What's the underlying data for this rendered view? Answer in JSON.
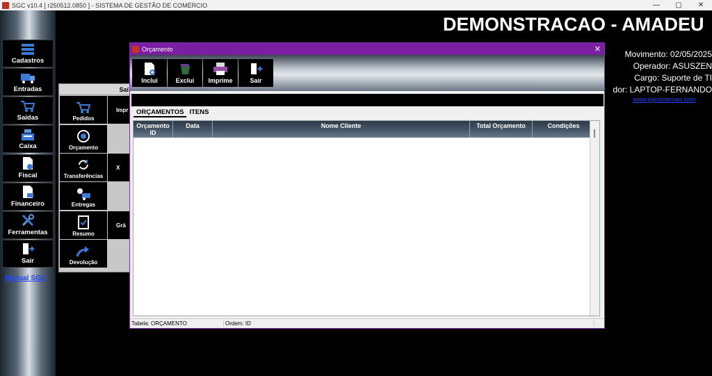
{
  "app": {
    "title": "SGC v10.4 [ r250512.0850 ] - SISTEMA DE GESTÃO DE COMÉRCIO",
    "window_controls": [
      "—",
      "▢",
      "✕"
    ]
  },
  "sidebar": {
    "items": [
      {
        "label": "Cadastros",
        "icon": "stack-icon"
      },
      {
        "label": "Entradas",
        "icon": "truck-icon"
      },
      {
        "label": "Saídas",
        "icon": "cart-icon"
      },
      {
        "label": "Caixa",
        "icon": "cash-register-icon"
      },
      {
        "label": "Fiscal",
        "icon": "document-icon"
      },
      {
        "label": "Financeiro",
        "icon": "finance-icon"
      },
      {
        "label": "Ferramentas",
        "icon": "tools-icon"
      },
      {
        "label": "Sair",
        "icon": "exit-door-icon"
      }
    ],
    "manual_link": "Manual SGC"
  },
  "header": {
    "company": "DEMONSTRACAO - AMADEU",
    "movimento": "Movimento: 02/05/2025",
    "operador": "Operador: ASUSZEN",
    "cargo": "Cargo: Suporte de TI",
    "computador": "dor: LAPTOP-FERNANDO",
    "website": "www.sgcsistemas.com"
  },
  "saidas_panel": {
    "title": "Saí",
    "items": [
      {
        "label": "Pedidos",
        "right": "Impr"
      },
      {
        "label": "Orçamento",
        "right": ""
      },
      {
        "label": "Transferências",
        "right": "X"
      },
      {
        "label": "Entregas",
        "right": ""
      },
      {
        "label": "Resumo",
        "right": "Grá"
      },
      {
        "label": "Devolução",
        "right": ""
      }
    ]
  },
  "orcamento_window": {
    "title": "Orçamento",
    "close": "✕",
    "toolbar": [
      {
        "label": "Inclui",
        "icon": "new-document-icon"
      },
      {
        "label": "Exclui",
        "icon": "delete-icon"
      },
      {
        "label": "Imprime",
        "icon": "printer-icon"
      },
      {
        "label": "Sair",
        "icon": "exit-door-icon"
      }
    ],
    "tabs": [
      "ORÇAMENTOS",
      "ITENS"
    ],
    "active_tab": "ORÇAMENTOS",
    "columns": [
      "Orçamento ID",
      "Data",
      "Nome Cliente",
      "Total Orçamento",
      "Condições"
    ],
    "rows": [],
    "status": {
      "tabela": "Tabela: ORÇAMENTO",
      "ordem": "Ordem: ID"
    }
  },
  "colors": {
    "window_title": "#7b1fa2",
    "link": "#2244ff",
    "background": "#000000"
  }
}
